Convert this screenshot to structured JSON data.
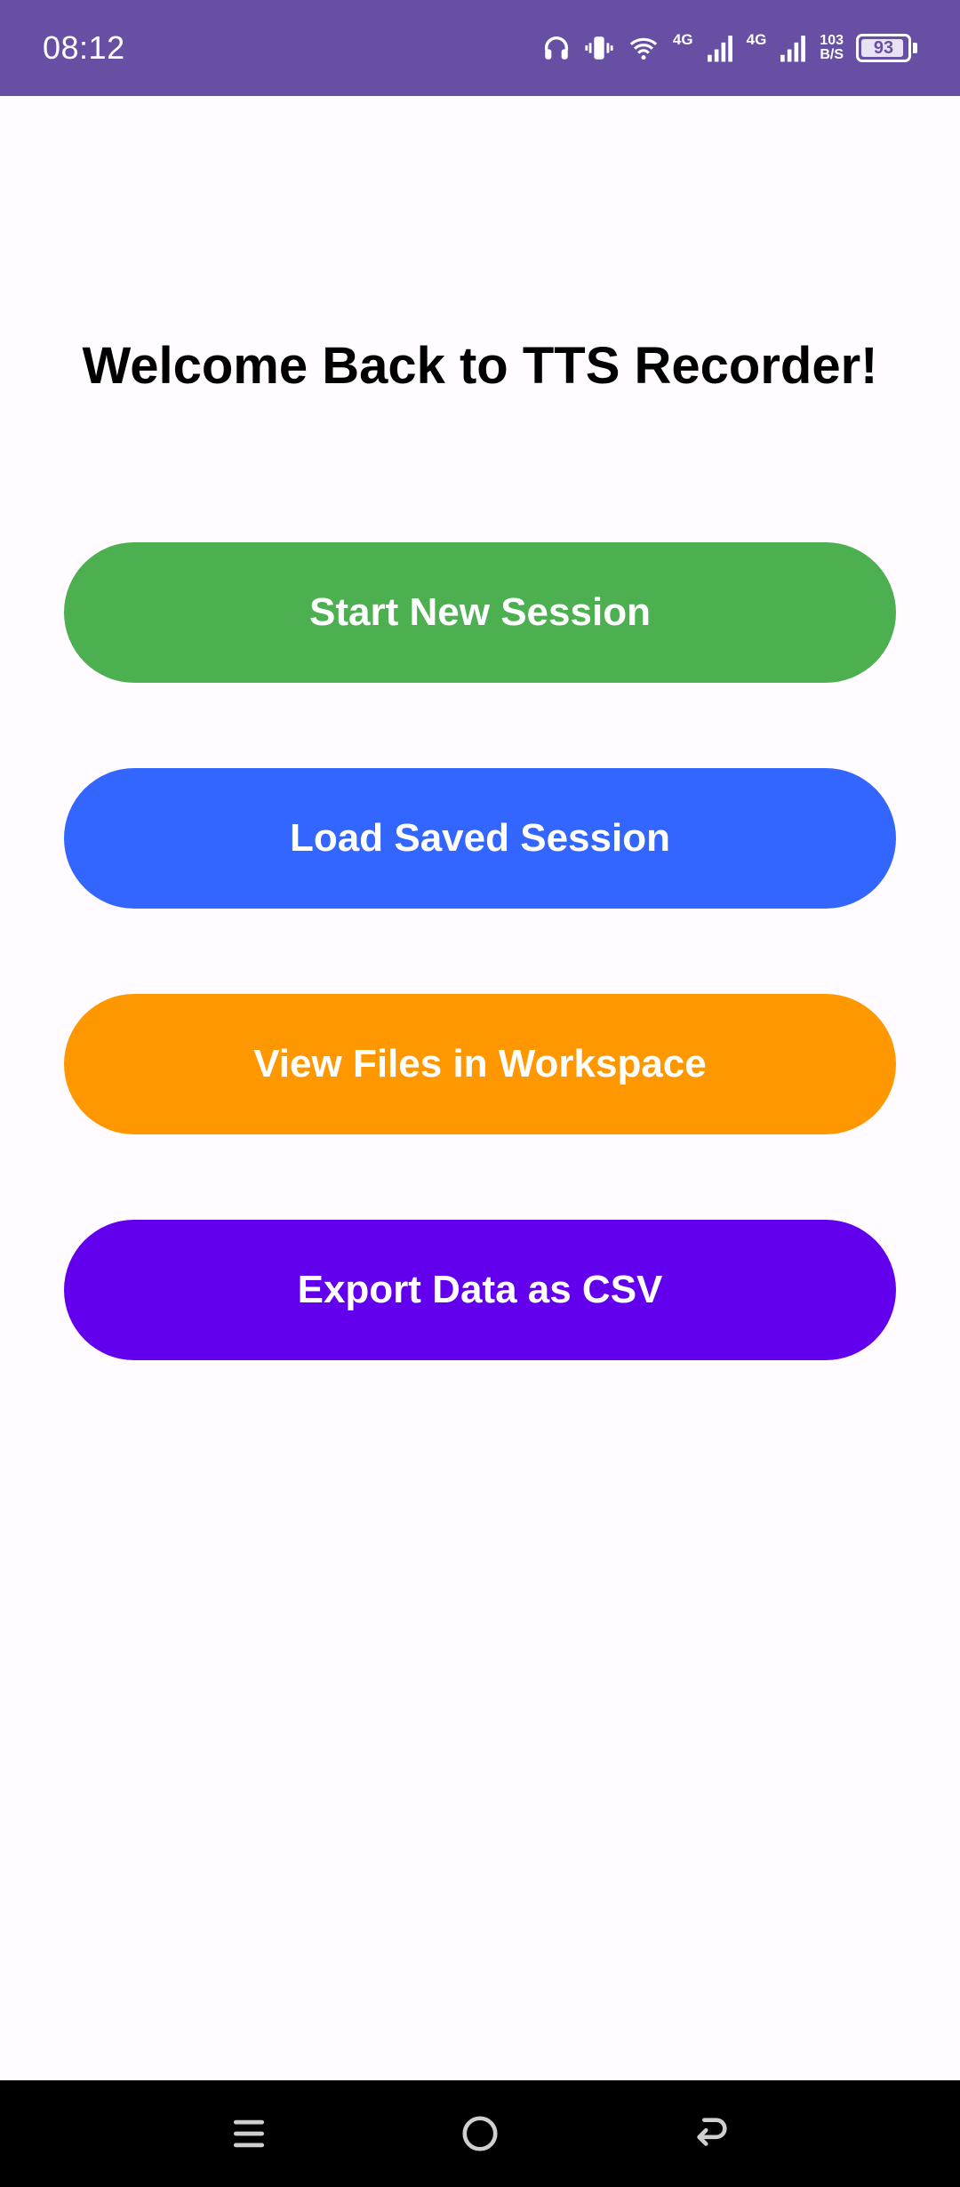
{
  "status_bar": {
    "time": "08:12",
    "network1": "4G",
    "network2": "4G",
    "speed_value": "103",
    "speed_unit": "B/S",
    "battery_level": "93",
    "icons": [
      "headphones-icon",
      "vibrate-icon",
      "wifi-icon",
      "signal-icon",
      "signal-icon",
      "battery-icon"
    ]
  },
  "main": {
    "title": "Welcome Back to TTS Recorder!",
    "buttons": [
      {
        "label": "Start New Session",
        "color": "#4CAF50"
      },
      {
        "label": "Load Saved Session",
        "color": "#3366FF"
      },
      {
        "label": "View Files in Workspace",
        "color": "#FF9800"
      },
      {
        "label": "Export Data as CSV",
        "color": "#6200EE"
      }
    ]
  },
  "nav_bar": {
    "icons": [
      "menu-icon",
      "home-icon",
      "back-icon"
    ]
  },
  "colors": {
    "status_bar": "#6750A4",
    "background": "#FFFBFE",
    "nav_bar": "#000000"
  }
}
